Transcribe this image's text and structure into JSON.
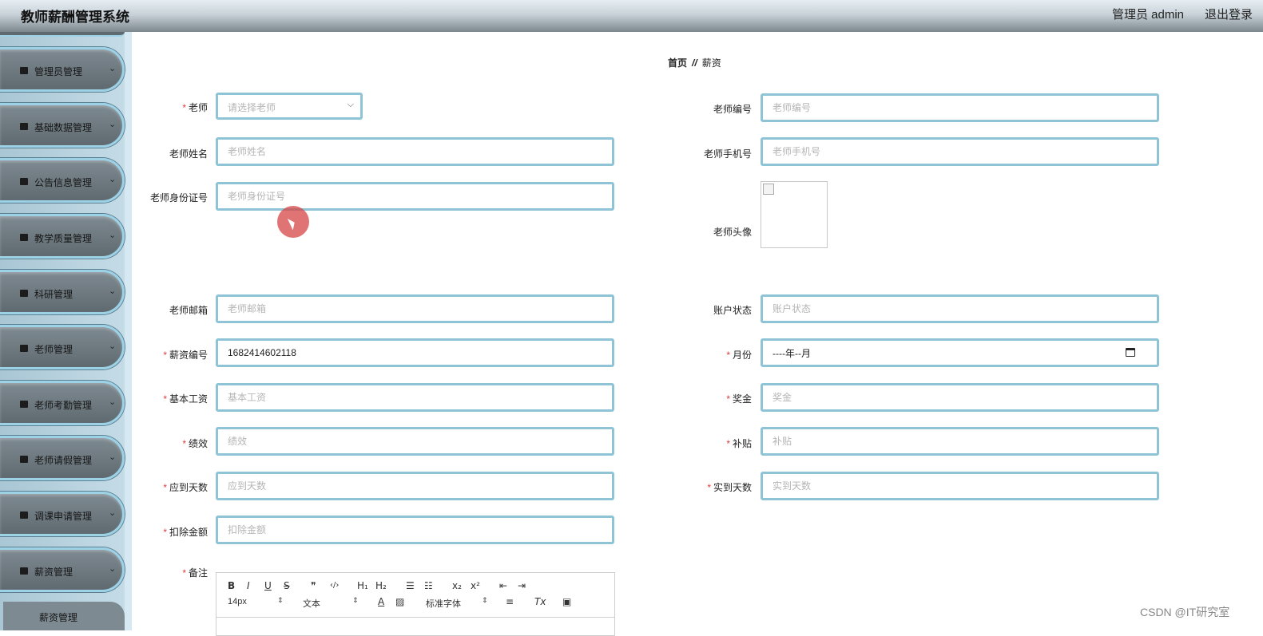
{
  "header": {
    "app_title": "教师薪酬管理系统",
    "admin_label": "管理员 admin",
    "logout_label": "退出登录"
  },
  "sidebar": {
    "items": [
      {
        "label": "管理员管理",
        "icon": "briefcase-icon"
      },
      {
        "label": "基础数据管理",
        "icon": "document-icon"
      },
      {
        "label": "公告信息管理",
        "icon": "grid-icon"
      },
      {
        "label": "教学质量管理",
        "icon": "grid-icon"
      },
      {
        "label": "科研管理",
        "icon": "clipboard-icon"
      },
      {
        "label": "老师管理",
        "icon": "user-icon"
      },
      {
        "label": "老师考勤管理",
        "icon": "grid-icon"
      },
      {
        "label": "老师请假管理",
        "icon": "chart-icon"
      },
      {
        "label": "调课申请管理",
        "icon": "monitor-icon"
      },
      {
        "label": "薪资管理",
        "icon": "sliders-icon"
      }
    ],
    "submenu": {
      "label": "薪资管理"
    }
  },
  "breadcrumb": {
    "home": "首页",
    "separator": "//",
    "current": "薪资"
  },
  "form": {
    "teacher": {
      "label": "老师",
      "placeholder": "请选择老师"
    },
    "teacher_no": {
      "label": "老师编号",
      "placeholder": "老师编号"
    },
    "teacher_name": {
      "label": "老师姓名",
      "placeholder": "老师姓名"
    },
    "teacher_phone": {
      "label": "老师手机号",
      "placeholder": "老师手机号"
    },
    "teacher_id_card": {
      "label": "老师身份证号",
      "placeholder": "老师身份证号"
    },
    "teacher_avatar": {
      "label": "老师头像"
    },
    "teacher_email": {
      "label": "老师邮箱",
      "placeholder": "老师邮箱"
    },
    "account_status": {
      "label": "账户状态",
      "placeholder": "账户状态"
    },
    "salary_no": {
      "label": "薪资编号",
      "value": "1682414602118"
    },
    "month": {
      "label": "月份",
      "value": "----年--月"
    },
    "base_salary": {
      "label": "基本工资",
      "placeholder": "基本工资"
    },
    "bonus": {
      "label": "奖金",
      "placeholder": "奖金"
    },
    "performance": {
      "label": "绩效",
      "placeholder": "绩效"
    },
    "allowance": {
      "label": "补贴",
      "placeholder": "补贴"
    },
    "due_days": {
      "label": "应到天数",
      "placeholder": "应到天数"
    },
    "actual_days": {
      "label": "实到天数",
      "placeholder": "实到天数"
    },
    "deduction": {
      "label": "扣除金额",
      "placeholder": "扣除金额"
    },
    "remark": {
      "label": "备注"
    },
    "required_mark": "*"
  },
  "editor_toolbar": {
    "bold": "B",
    "italic": "I",
    "underline": "U",
    "strike": "S",
    "quote": "❞",
    "code": "‹/›",
    "h1": "H₁",
    "h2": "H₂",
    "ordered_list": "☰",
    "bullet_list": "☷",
    "subscript": "x₂",
    "superscript": "x²",
    "outdent": "⇤",
    "indent": "⇥",
    "font_size": "14px",
    "paragraph": "文本",
    "font_family": "标准字体",
    "font_color": "A",
    "background": "▨",
    "align": "≡",
    "clear_format": "Tx",
    "image": "▣"
  },
  "watermark": "CSDN @IT研究室",
  "colors": {
    "input_border": "#8fc3d6",
    "required": "#e23b3b",
    "menu_bg": "#6e7a80"
  }
}
